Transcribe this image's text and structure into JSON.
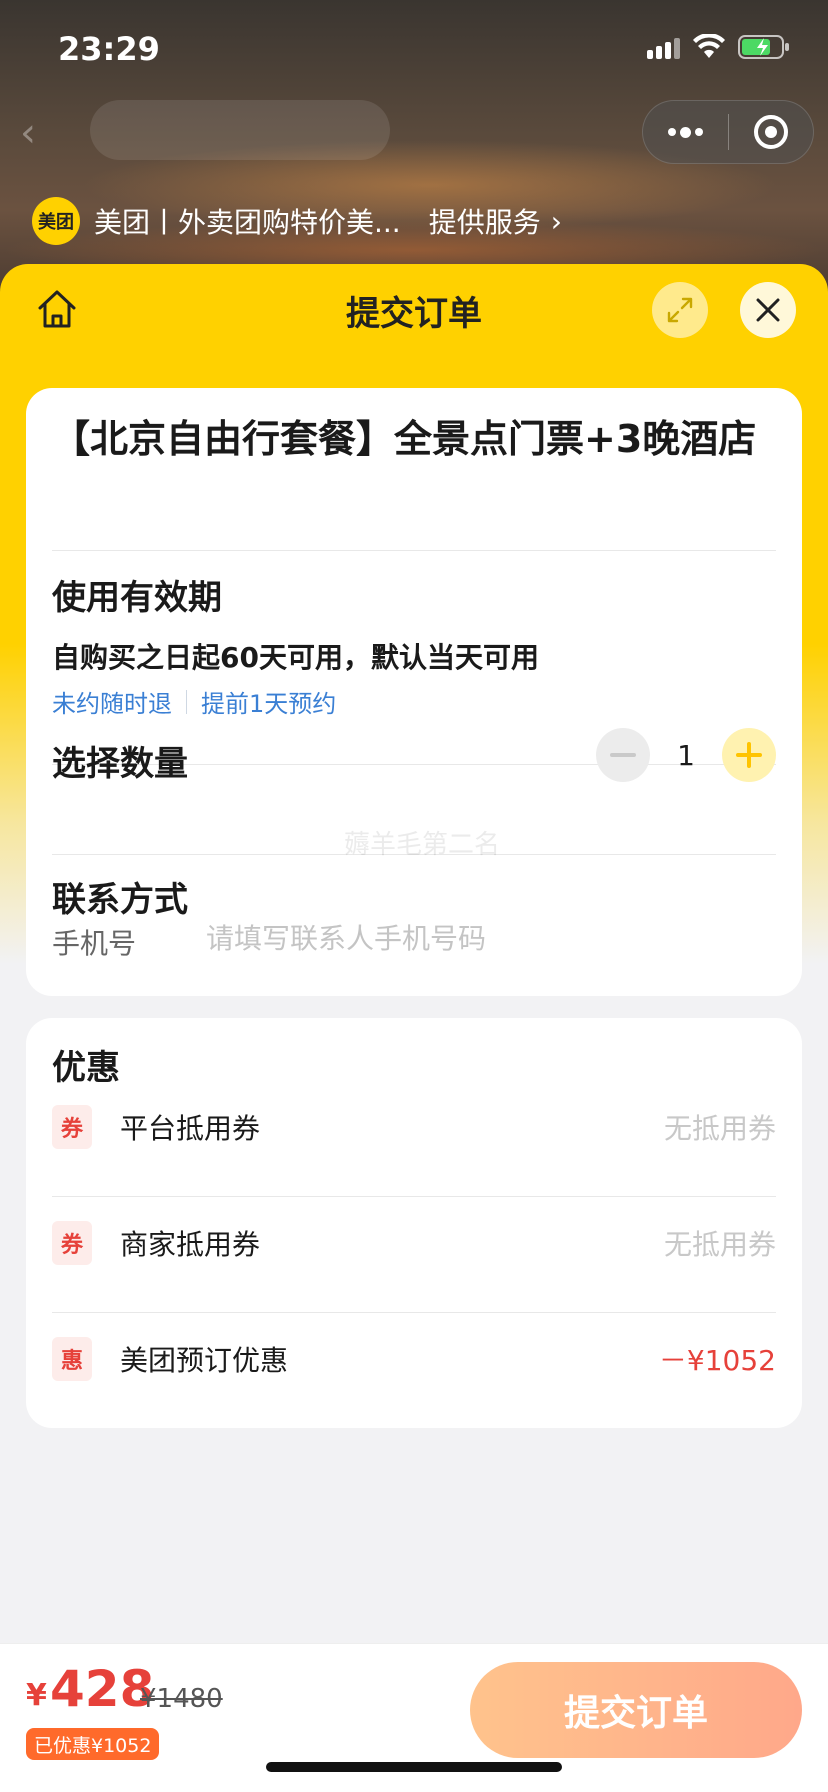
{
  "status_bar": {
    "time": "23:29"
  },
  "provider": {
    "logo_text": "美团",
    "name": "美团丨外卖团购特价美...",
    "service_label": "提供服务",
    "chevron": "›"
  },
  "sheet": {
    "title": "提交订单",
    "icons": {
      "home": "home-icon",
      "expand": "expand-icon",
      "close": "close-icon"
    }
  },
  "product": {
    "title": "【北京自由行套餐】全景点门票+3晚酒店"
  },
  "validity": {
    "label": "使用有效期",
    "text": "自购买之日起60天可用，默认当天可用",
    "tags": [
      "未约随时退",
      "提前1天预约"
    ]
  },
  "quantity": {
    "label": "选择数量",
    "value": "1"
  },
  "watermark": "薅羊毛第二名",
  "contact": {
    "label": "联系方式",
    "phone_label": "手机号",
    "phone_placeholder": "请填写联系人手机号码",
    "phone_value": ""
  },
  "discounts": {
    "title": "优惠",
    "items": [
      {
        "icon_text": "券",
        "name": "平台抵用券",
        "value": "无抵用券"
      },
      {
        "icon_text": "券",
        "name": "商家抵用券",
        "value": "无抵用券"
      },
      {
        "icon_text": "惠",
        "name": "美团预订优惠",
        "value": "－¥1052"
      }
    ]
  },
  "footer": {
    "currency": "¥",
    "price": "428",
    "original_price": "¥1480",
    "saved_label": "已优惠¥1052",
    "submit_label": "提交订单"
  },
  "colors": {
    "brand_yellow": "#ffd100",
    "discount_red": "#e6413a",
    "tag_blue": "#3a7fd4",
    "submit_gradient_start": "#ffc38c",
    "submit_gradient_end": "#ffa88a"
  }
}
